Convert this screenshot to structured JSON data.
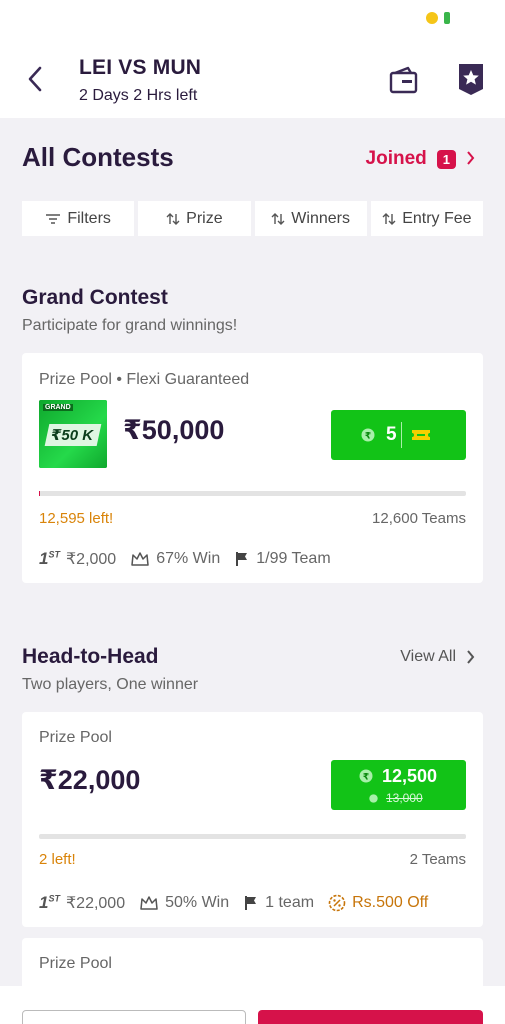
{
  "header": {
    "title": "LEI VS MUN",
    "time_left": "2 Days 2 Hrs  left"
  },
  "contests": {
    "heading": "All Contests",
    "joined_label": "Joined",
    "joined_count": "1"
  },
  "filters": [
    {
      "label": "Filters",
      "icon": "filter-icon"
    },
    {
      "label": "Prize",
      "icon": "sort-icon"
    },
    {
      "label": "Winners",
      "icon": "sort-icon"
    },
    {
      "label": "Entry Fee",
      "icon": "sort-icon"
    }
  ],
  "grand": {
    "title": "Grand Contest",
    "subtitle": "Participate for grand winnings!",
    "pool_label": "Prize Pool • Flexi Guaranteed",
    "thumb_top": "GRAND",
    "thumb_main": "₹50 K",
    "prize": "₹50,000",
    "entry": "5",
    "spots_left": "12,595 left!",
    "total_teams": "12,600 Teams",
    "first_prize": "₹2,000",
    "win_pct": "67% Win",
    "team_limit": "1/99 Team",
    "progress": 0.0004
  },
  "h2h": {
    "title": "Head-to-Head",
    "subtitle": "Two players, One winner",
    "view_all": "View All",
    "pool_label": "Prize Pool",
    "prize": "₹22,000",
    "entry": "12,500",
    "entry_original": "13,000",
    "spots_left": "2 left!",
    "total_teams": "2 Teams",
    "first_prize": "₹22,000",
    "win_pct": "50% Win",
    "team_limit": "1 team",
    "discount": "Rs.500 Off",
    "progress": 0
  },
  "third": {
    "pool_label": "Prize Pool"
  },
  "first_rank_label": "1",
  "first_rank_sup": "ST",
  "colors": {
    "accent": "#d6124a",
    "join_green": "#12c317",
    "dark_text": "#2a1b3d",
    "warning": "#d9840a"
  }
}
